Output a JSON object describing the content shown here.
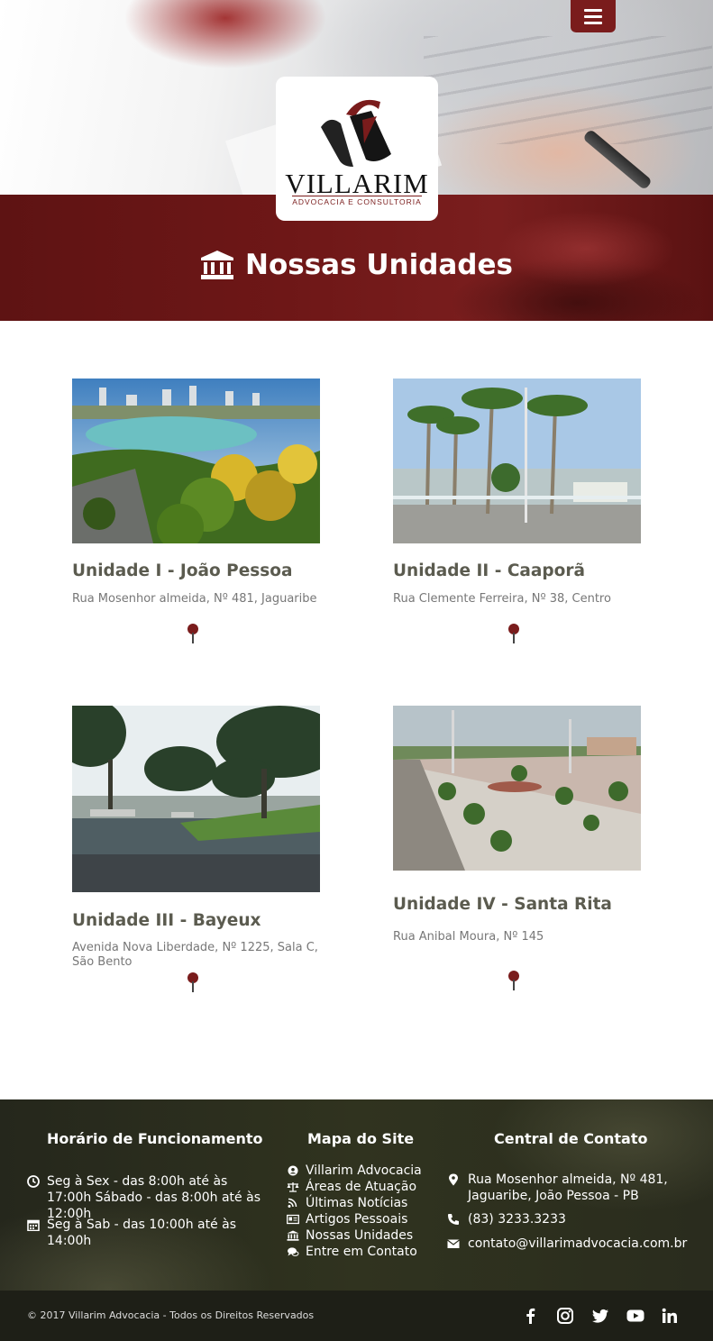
{
  "header": {
    "logo_title": "VILLARIM",
    "logo_subtitle": "ADVOCACIA E CONSULTORIA",
    "menu_icon": "hamburger-menu-icon",
    "page_title": "Nossas Unidades",
    "title_icon": "institution-icon",
    "accent_color": "#7a1c1c"
  },
  "units": [
    {
      "title": "Unidade I - João Pessoa",
      "address": "Rua Mosenhor almeida, Nº 481, Jaguaribe",
      "pin_icon": "map-pin-icon"
    },
    {
      "title": "Unidade II - Caaporã",
      "address": "Rua Clemente Ferreira, Nº 38, Centro",
      "pin_icon": "map-pin-icon"
    },
    {
      "title": "Unidade III - Bayeux",
      "address": "Avenida Nova Liberdade, Nº 1225, Sala C, São Bento",
      "pin_icon": "map-pin-icon"
    },
    {
      "title": "Unidade IV - Santa Rita",
      "address": "Rua Anibal Moura, Nº 145",
      "pin_icon": "map-pin-icon"
    }
  ],
  "footer": {
    "hours": {
      "title": "Horário de Funcionamento",
      "items": [
        {
          "icon": "clock-icon",
          "text": "Seg à Sex - das 8:00h até às 17:00h Sábado - das 8:00h até às 12:00h"
        },
        {
          "icon": "calendar-icon",
          "text": "Seg à Sab - das 10:00h até às 14:00h"
        }
      ]
    },
    "sitemap": {
      "title": "Mapa do Site",
      "items": [
        {
          "icon": "user-circle-icon",
          "label": "Villarim Advocacia"
        },
        {
          "icon": "balance-scale-icon",
          "label": "Áreas de Atuação"
        },
        {
          "icon": "rss-icon",
          "label": "Últimas Notícias"
        },
        {
          "icon": "id-card-icon",
          "label": "Artigos Pessoais"
        },
        {
          "icon": "institution-icon",
          "label": "Nossas Unidades"
        },
        {
          "icon": "chat-icon",
          "label": "Entre em Contato"
        }
      ]
    },
    "contact": {
      "title": "Central de Contato",
      "address": "Rua Mosenhor almeida, Nº 481, Jaguaribe, João Pessoa - PB",
      "phone": "(83) 3233.3233",
      "email": "contato@villarimadvocacia.com.br"
    },
    "copyright": "© 2017 Villarim Advocacia - Todos os Direitos Reservados",
    "social": [
      "facebook-icon",
      "instagram-icon",
      "twitter-icon",
      "youtube-icon",
      "linkedin-icon"
    ]
  }
}
